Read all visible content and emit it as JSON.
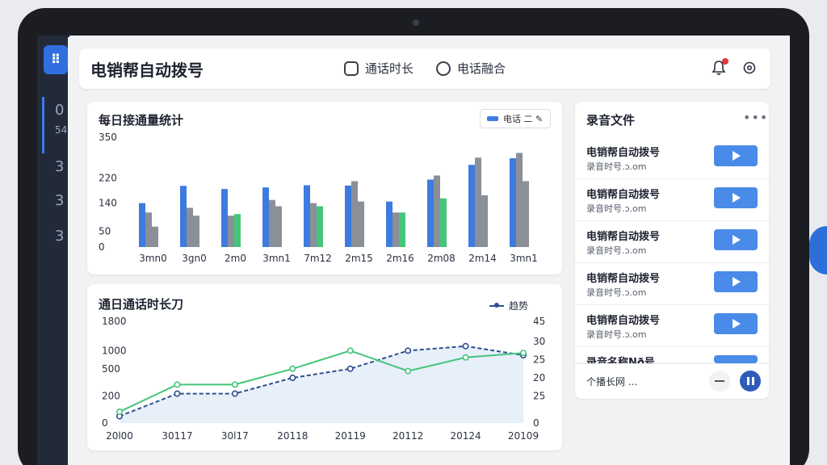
{
  "app": {
    "title": "电销帮自动拨号"
  },
  "topbar": {
    "nav": [
      {
        "label": "通话时长",
        "icon": "chat-icon"
      },
      {
        "label": "电话融合",
        "icon": "download-icon"
      }
    ],
    "notification_icon": "bell-icon",
    "settings_icon": "gear-icon"
  },
  "background_app": {
    "numbers": [
      "0",
      "54",
      "3",
      "3",
      "3"
    ]
  },
  "bar_card": {
    "title": "每日接通量统计",
    "legend": "电话 二 ✎"
  },
  "line_card": {
    "title": "通日通话时长刀",
    "legend": "趋势"
  },
  "recordings": {
    "title": "录音文件",
    "items": [
      {
        "name": "电销帮自动拨号",
        "sub": "录音时号.ɔ.om"
      },
      {
        "name": "电销帮自动拨号",
        "sub": "录音时号.ɔ.om"
      },
      {
        "name": "电销帮自动拨号",
        "sub": "录音时号.ɔ.om"
      },
      {
        "name": "电销帮自动拨号",
        "sub": "录音时号.ɔ.om"
      },
      {
        "name": "电销帮自动拨号",
        "sub": "录音时号.ɔ.om"
      },
      {
        "name": "录音名称Nð号",
        "sub": ""
      }
    ],
    "player_text": "个播长网 ..."
  },
  "colors": {
    "blue": "#3d7be0",
    "gray": "#8a8f98",
    "green": "#45c57a",
    "navy": "#2f4f8f"
  },
  "chart_data": [
    {
      "type": "bar",
      "title": "每日接通量统计",
      "categories": [
        "3mn0",
        "3gn0",
        "2m0",
        "3mn1",
        "7m12",
        "2m15",
        "2m16",
        "2m08",
        "2m14",
        "3mn1"
      ],
      "yticks": [
        "350",
        "220",
        "140",
        "50",
        "0"
      ],
      "ylim": [
        0,
        350
      ],
      "series": [
        {
          "values": [
            140,
            195,
            185,
            190,
            197,
            196,
            145,
            215,
            262,
            283
          ]
        },
        {
          "values": [
            110,
            125,
            100,
            150,
            140,
            210,
            110,
            228,
            285,
            300
          ]
        },
        {
          "values": [
            65,
            100,
            0,
            130,
            0,
            145,
            0,
            0,
            165,
            210
          ]
        },
        {
          "values": [
            0,
            0,
            105,
            0,
            130,
            0,
            110,
            155,
            0,
            0
          ]
        }
      ]
    },
    {
      "type": "line",
      "title": "通日通话时长刀",
      "x": [
        "20l00",
        "30117",
        "30l17",
        "20118",
        "20119",
        "20112",
        "20124",
        "20109"
      ],
      "yticks_left": [
        "1800",
        "1000",
        "500",
        "200",
        "0"
      ],
      "yticks_right": [
        "45",
        "30",
        "25",
        "20",
        "25",
        "0"
      ],
      "series": [
        {
          "values": [
            3,
            13,
            13,
            20,
            24,
            32,
            34,
            30
          ]
        },
        {
          "values": [
            5,
            17,
            17,
            24,
            32,
            23,
            29,
            31
          ]
        }
      ]
    }
  ]
}
